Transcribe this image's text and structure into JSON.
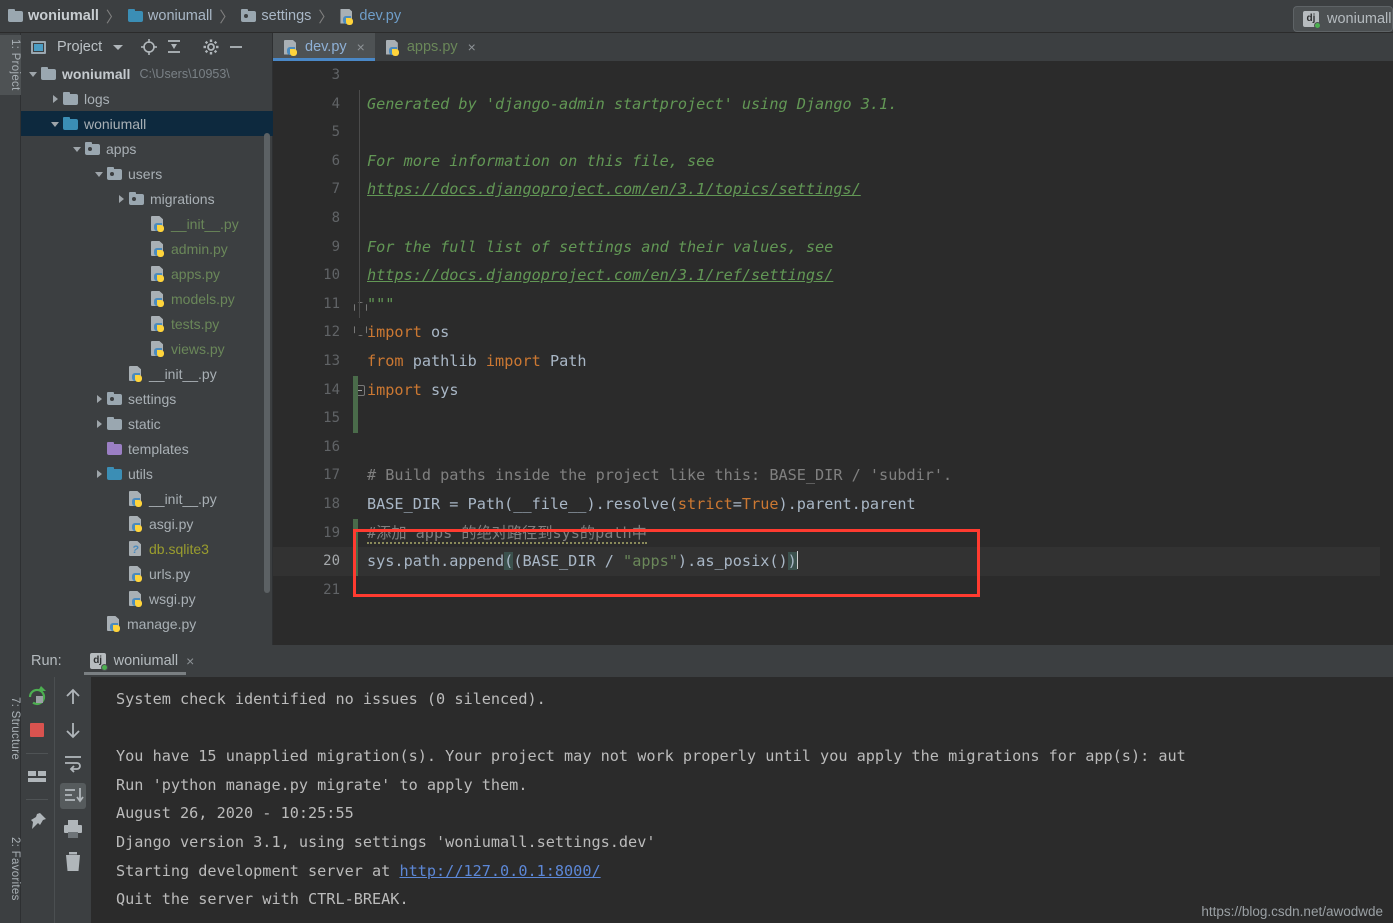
{
  "breadcrumb": {
    "items": [
      {
        "label": "woniumall",
        "icon": "folder-icon",
        "style": "bold"
      },
      {
        "label": "woniumall",
        "icon": "folder-icon-blue",
        "style": "normal"
      },
      {
        "label": "settings",
        "icon": "package-folder-icon",
        "style": "normal"
      },
      {
        "label": "dev.py",
        "icon": "python-file-icon",
        "style": "file"
      }
    ],
    "separator": "〉"
  },
  "run_config_widget": {
    "name": "woniumall",
    "icon": "django-icon"
  },
  "left_rail": {
    "tabs": [
      {
        "label": "1: Project",
        "active": true
      },
      {
        "label": "7: Structure",
        "active": false
      },
      {
        "label": "2: Favorites",
        "active": false
      }
    ]
  },
  "project_panel": {
    "title": "Project",
    "toolbar": [
      {
        "name": "locate-icon",
        "label": "Select Opened File"
      },
      {
        "name": "collapse-all-icon",
        "label": "Collapse All"
      },
      {
        "name": "gear-icon",
        "label": "Settings"
      },
      {
        "name": "minimize-icon",
        "label": "Hide"
      }
    ],
    "tree": [
      {
        "label": "woniumall",
        "path": "C:\\Users\\10953\\",
        "icon": "folder-icon",
        "arrow": "open",
        "indent": 0,
        "style": "bold",
        "selected": false
      },
      {
        "label": "logs",
        "path": "",
        "icon": "folder-icon",
        "arrow": "closed",
        "indent": 1,
        "style": "normal",
        "selected": false
      },
      {
        "label": "woniumall",
        "path": "",
        "icon": "folder-icon-blue",
        "arrow": "open",
        "indent": 1,
        "style": "normal",
        "selected": true
      },
      {
        "label": "apps",
        "path": "",
        "icon": "package-folder-icon",
        "arrow": "open",
        "indent": 2,
        "style": "normal",
        "selected": false
      },
      {
        "label": "users",
        "path": "",
        "icon": "package-folder-icon",
        "arrow": "open",
        "indent": 3,
        "style": "normal",
        "selected": false
      },
      {
        "label": "migrations",
        "path": "",
        "icon": "package-folder-icon",
        "arrow": "closed",
        "indent": 4,
        "style": "normal",
        "selected": false
      },
      {
        "label": "__init__.py",
        "path": "",
        "icon": "python-file-icon",
        "arrow": "none",
        "indent": 5,
        "style": "green",
        "selected": false
      },
      {
        "label": "admin.py",
        "path": "",
        "icon": "python-file-icon",
        "arrow": "none",
        "indent": 5,
        "style": "green",
        "selected": false
      },
      {
        "label": "apps.py",
        "path": "",
        "icon": "python-file-icon",
        "arrow": "none",
        "indent": 5,
        "style": "green",
        "selected": false
      },
      {
        "label": "models.py",
        "path": "",
        "icon": "python-file-icon",
        "arrow": "none",
        "indent": 5,
        "style": "green",
        "selected": false
      },
      {
        "label": "tests.py",
        "path": "",
        "icon": "python-file-icon",
        "arrow": "none",
        "indent": 5,
        "style": "green",
        "selected": false
      },
      {
        "label": "views.py",
        "path": "",
        "icon": "python-file-icon",
        "arrow": "none",
        "indent": 5,
        "style": "green",
        "selected": false
      },
      {
        "label": "__init__.py",
        "path": "",
        "icon": "python-file-icon",
        "arrow": "none",
        "indent": 4,
        "style": "normal",
        "selected": false
      },
      {
        "label": "settings",
        "path": "",
        "icon": "package-folder-icon",
        "arrow": "closed",
        "indent": 3,
        "style": "normal",
        "selected": false
      },
      {
        "label": "static",
        "path": "",
        "icon": "folder-icon",
        "arrow": "closed",
        "indent": 3,
        "style": "normal",
        "selected": false
      },
      {
        "label": "templates",
        "path": "",
        "icon": "folder-icon-purple",
        "arrow": "none",
        "indent": 3,
        "style": "normal",
        "selected": false
      },
      {
        "label": "utils",
        "path": "",
        "icon": "folder-icon-blue",
        "arrow": "closed",
        "indent": 3,
        "style": "normal",
        "selected": false
      },
      {
        "label": "__init__.py",
        "path": "",
        "icon": "python-file-icon",
        "arrow": "none",
        "indent": 4,
        "style": "normal",
        "selected": false
      },
      {
        "label": "asgi.py",
        "path": "",
        "icon": "python-file-icon",
        "arrow": "none",
        "indent": 4,
        "style": "normal",
        "selected": false
      },
      {
        "label": "db.sqlite3",
        "path": "",
        "icon": "unknown-file-icon",
        "arrow": "none",
        "indent": 4,
        "style": "olive",
        "selected": false
      },
      {
        "label": "urls.py",
        "path": "",
        "icon": "python-file-icon",
        "arrow": "none",
        "indent": 4,
        "style": "normal",
        "selected": false
      },
      {
        "label": "wsgi.py",
        "path": "",
        "icon": "python-file-icon",
        "arrow": "none",
        "indent": 4,
        "style": "normal",
        "selected": false
      },
      {
        "label": "manage.py",
        "path": "",
        "icon": "python-file-icon",
        "arrow": "none",
        "indent": 3,
        "style": "normal",
        "selected": false
      }
    ]
  },
  "editor": {
    "tabs": [
      {
        "label": "dev.py",
        "active": true,
        "close": "×",
        "color": "blue"
      },
      {
        "label": "apps.py",
        "active": false,
        "close": "×",
        "color": "green"
      }
    ],
    "first_line_number": 3,
    "current_line": 20,
    "lines": [
      {
        "n": 3,
        "text": ""
      },
      {
        "n": 4,
        "text": "Generated by 'django-admin startproject' using Django 3.1."
      },
      {
        "n": 5,
        "text": ""
      },
      {
        "n": 6,
        "text": "For more information on this file, see"
      },
      {
        "n": 7,
        "text": "https://docs.djangoproject.com/en/3.1/topics/settings/"
      },
      {
        "n": 8,
        "text": ""
      },
      {
        "n": 9,
        "text": "For the full list of settings and their values, see"
      },
      {
        "n": 10,
        "text": "https://docs.djangoproject.com/en/3.1/ref/settings/"
      },
      {
        "n": 11,
        "text": "\"\"\""
      },
      {
        "n": 12,
        "text": "import os"
      },
      {
        "n": 13,
        "text": "from pathlib import Path"
      },
      {
        "n": 14,
        "text": "import sys"
      },
      {
        "n": 15,
        "text": ""
      },
      {
        "n": 16,
        "text": ""
      },
      {
        "n": 17,
        "text": "# Build paths inside the project like this: BASE_DIR / 'subdir'."
      },
      {
        "n": 18,
        "text": "BASE_DIR = Path(__file__).resolve(strict=True).parent.parent"
      },
      {
        "n": 19,
        "text": "#添加 apps 的绝对路径到sys的path中"
      },
      {
        "n": 20,
        "text": "sys.path.append((BASE_DIR / \"apps\").as_posix())"
      },
      {
        "n": 21,
        "text": ""
      }
    ],
    "annotation": {
      "name": "red-highlight-box",
      "color": "#ff3b30"
    }
  },
  "run_panel": {
    "label": "Run:",
    "tab_name": "woniumall",
    "tab_close": "×",
    "left_tools": [
      {
        "name": "rerun-icon",
        "label": "Rerun"
      },
      {
        "name": "stop-icon",
        "label": "Stop"
      },
      {
        "name": "layout-icon",
        "label": "Layout"
      },
      {
        "name": "pin-icon",
        "label": "Pin Tab"
      }
    ],
    "right_tools": [
      {
        "name": "up-arrow-icon",
        "label": "Up the Stack Trace"
      },
      {
        "name": "down-arrow-icon",
        "label": "Down the Stack Trace"
      },
      {
        "name": "soft-wrap-icon",
        "label": "Use Soft Wraps"
      },
      {
        "name": "scroll-end-icon",
        "label": "Scroll to the End",
        "active": true
      },
      {
        "name": "print-icon",
        "label": "Print"
      },
      {
        "name": "trash-icon",
        "label": "Clear All"
      }
    ],
    "console_lines": [
      {
        "text": "System check identified no issues (0 silenced).",
        "link": ""
      },
      {
        "text": "",
        "link": ""
      },
      {
        "text": "You have 15 unapplied migration(s). Your project may not work properly until you apply the migrations for app(s): aut",
        "link": ""
      },
      {
        "text": "Run 'python manage.py migrate' to apply them.",
        "link": ""
      },
      {
        "text": "August 26, 2020 - 10:25:55",
        "link": ""
      },
      {
        "text": "Django version 3.1, using settings 'woniumall.settings.dev'",
        "link": ""
      },
      {
        "text": "Starting development server at ",
        "link": "http://127.0.0.1:8000/"
      },
      {
        "text": "Quit the server with CTRL-BREAK.",
        "link": ""
      }
    ]
  },
  "watermark": "https://blog.csdn.net/awodwde",
  "colors": {
    "accent": "#4a88c7",
    "annotation": "#ff3b30",
    "selection": "#0d293e",
    "editor_bg": "#2b2b2b",
    "chrome_bg": "#3c3f41",
    "comment": "#629755",
    "keyword": "#cc7832",
    "string": "#6a8759"
  }
}
